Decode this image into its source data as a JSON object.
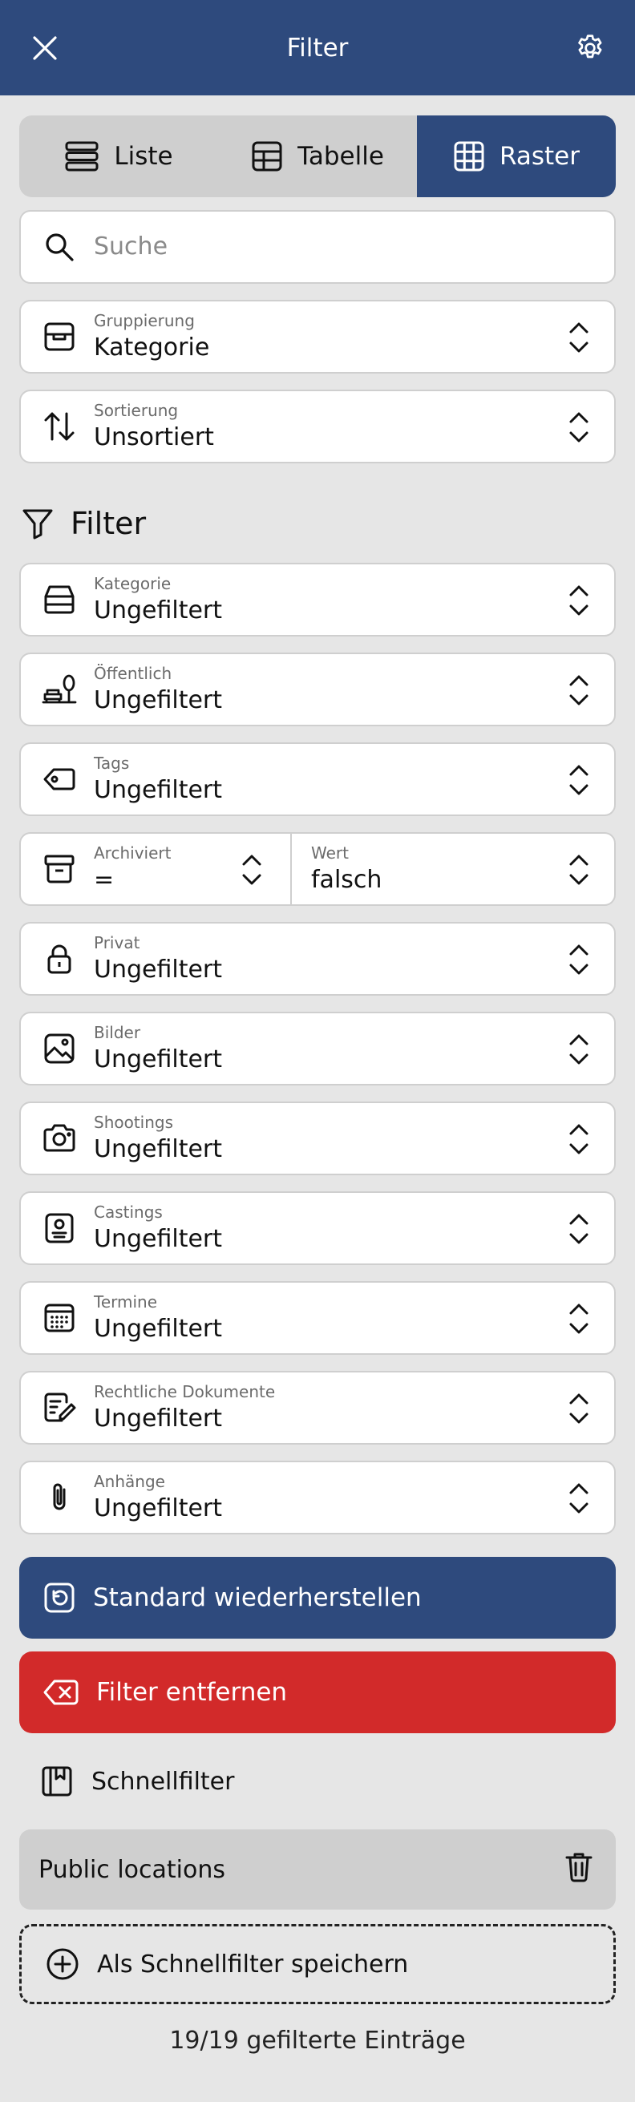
{
  "header": {
    "title": "Filter",
    "close_icon": "close-icon",
    "settings_icon": "gear-icon"
  },
  "view_switch": {
    "items": [
      {
        "label": "Liste",
        "icon": "list-icon",
        "active": false
      },
      {
        "label": "Tabelle",
        "icon": "table-icon",
        "active": false
      },
      {
        "label": "Raster",
        "icon": "grid-icon",
        "active": true
      }
    ]
  },
  "search": {
    "placeholder": "Suche",
    "value": ""
  },
  "grouping": {
    "label": "Gruppierung",
    "value": "Kategorie"
  },
  "sorting": {
    "label": "Sortierung",
    "value": "Unsortiert"
  },
  "filter_section": {
    "title": "Filter"
  },
  "filters": [
    {
      "label": "Kategorie",
      "value": "Ungefiltert"
    },
    {
      "label": "Öffentlich",
      "value": "Ungefiltert"
    },
    {
      "label": "Tags",
      "value": "Ungefiltert"
    },
    {
      "label": "Archiviert",
      "value": "=",
      "value_label": "Wert",
      "value_value": "falsch"
    },
    {
      "label": "Privat",
      "value": "Ungefiltert"
    },
    {
      "label": "Bilder",
      "value": "Ungefiltert"
    },
    {
      "label": "Shootings",
      "value": "Ungefiltert"
    },
    {
      "label": "Castings",
      "value": "Ungefiltert"
    },
    {
      "label": "Termine",
      "value": "Ungefiltert"
    },
    {
      "label": "Rechtliche Dokumente",
      "value": "Ungefiltert"
    },
    {
      "label": "Anhänge",
      "value": "Ungefiltert"
    }
  ],
  "actions": {
    "restore_label": "Standard wiederherstellen",
    "remove_label": "Filter entfernen"
  },
  "quick_filters": {
    "title": "Schnellfilter",
    "items": [
      {
        "label": "Public locations"
      }
    ],
    "save_label": "Als Schnellfilter speichern"
  },
  "footer": {
    "count_text": "19/19 gefilterte Einträge"
  },
  "colors": {
    "primary": "#2e4a7d",
    "danger": "#d22a2a",
    "background": "#e6e6e6"
  }
}
